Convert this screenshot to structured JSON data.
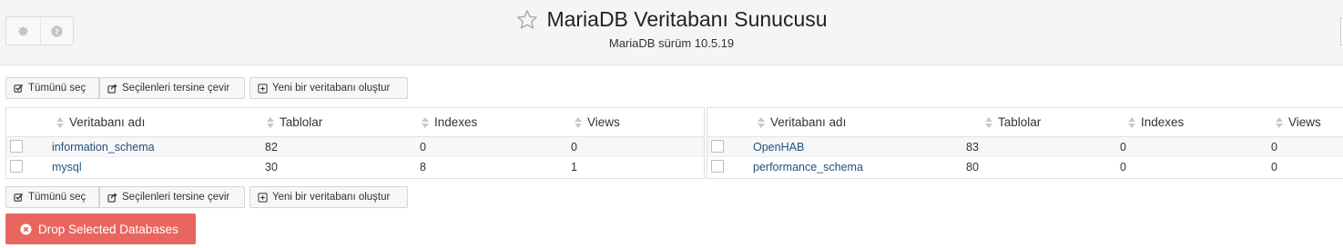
{
  "header": {
    "title": "MariaDB Veritabanı Sunucusu",
    "subtitle": "MariaDB sürüm 10.5.19",
    "icons": [
      "gear-icon",
      "help-icon",
      "star-icon"
    ]
  },
  "actions": {
    "select_all": "Tümünü seç",
    "invert_selection": "Seçilenleri tersine çevir",
    "create_database": "Yeni bir veritabanı oluştur"
  },
  "table": {
    "columns": [
      "Veritabanı adı",
      "Tablolar",
      "Indexes",
      "Views"
    ]
  },
  "left_rows": [
    {
      "name": "information_schema",
      "tables": "82",
      "indexes": "0",
      "views": "0"
    },
    {
      "name": "mysql",
      "tables": "30",
      "indexes": "8",
      "views": "1"
    }
  ],
  "right_rows": [
    {
      "name": "OpenHAB",
      "tables": "83",
      "indexes": "0",
      "views": "0"
    },
    {
      "name": "performance_schema",
      "tables": "80",
      "indexes": "0",
      "views": "0"
    }
  ],
  "drop_button": {
    "label": "Drop Selected Databases",
    "color": "#e8665f"
  },
  "colors": {
    "link": "#23527c",
    "header_bg": "#f5f5f5"
  }
}
